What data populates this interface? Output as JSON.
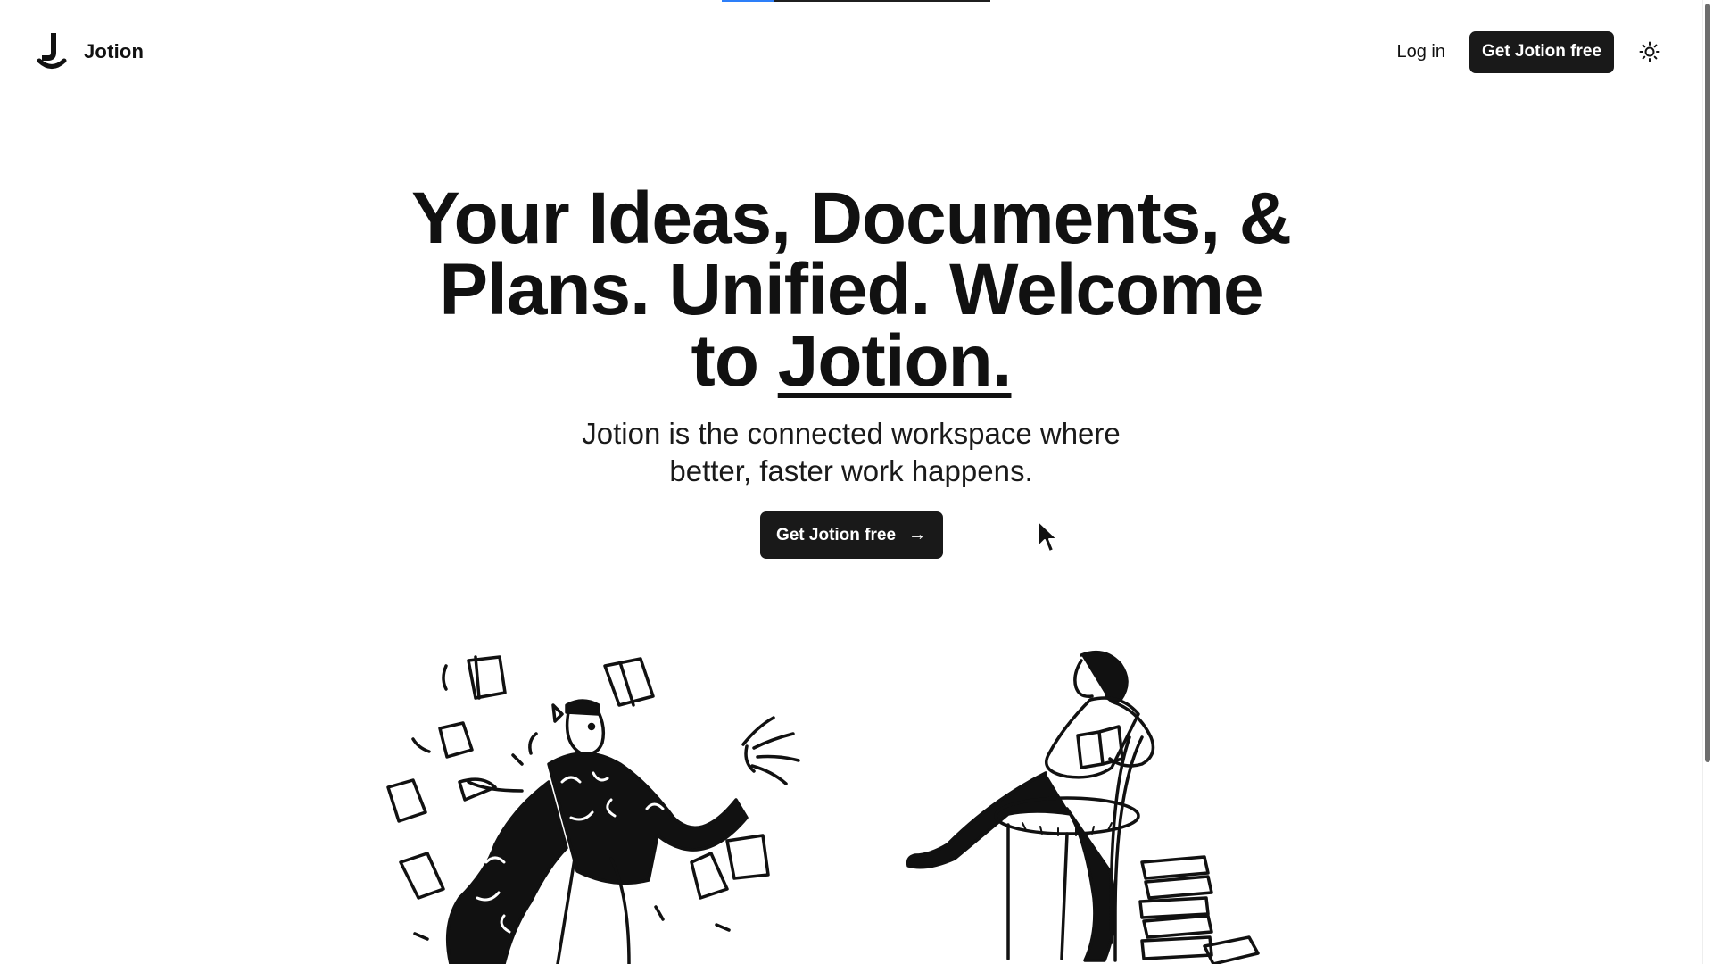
{
  "loading_progress": 0.196,
  "nav": {
    "brand_name": "Jotion",
    "logo_icon": "jotion-logo-icon",
    "login_label": "Log in",
    "cta_label": "Get Jotion free",
    "theme_icon": "sun-icon"
  },
  "hero": {
    "title_part1": "Your Ideas, Documents, &",
    "title_part2": "Plans. Unified. Welcome",
    "title_part3": "to",
    "title_brand": "Jotion.",
    "subtitle": "Jotion is the connected workspace where better, faster work happens.",
    "cta_label": "Get Jotion free",
    "cta_icon": "arrow-right-icon"
  },
  "illustrations": {
    "left": "documents-juggler-illustration",
    "right": "reading-person-illustration"
  },
  "colors": {
    "background": "#ffffff",
    "text": "#111111",
    "button": "#191919",
    "button_text": "#ffffff",
    "progress_accent": "#2d7ff9"
  }
}
